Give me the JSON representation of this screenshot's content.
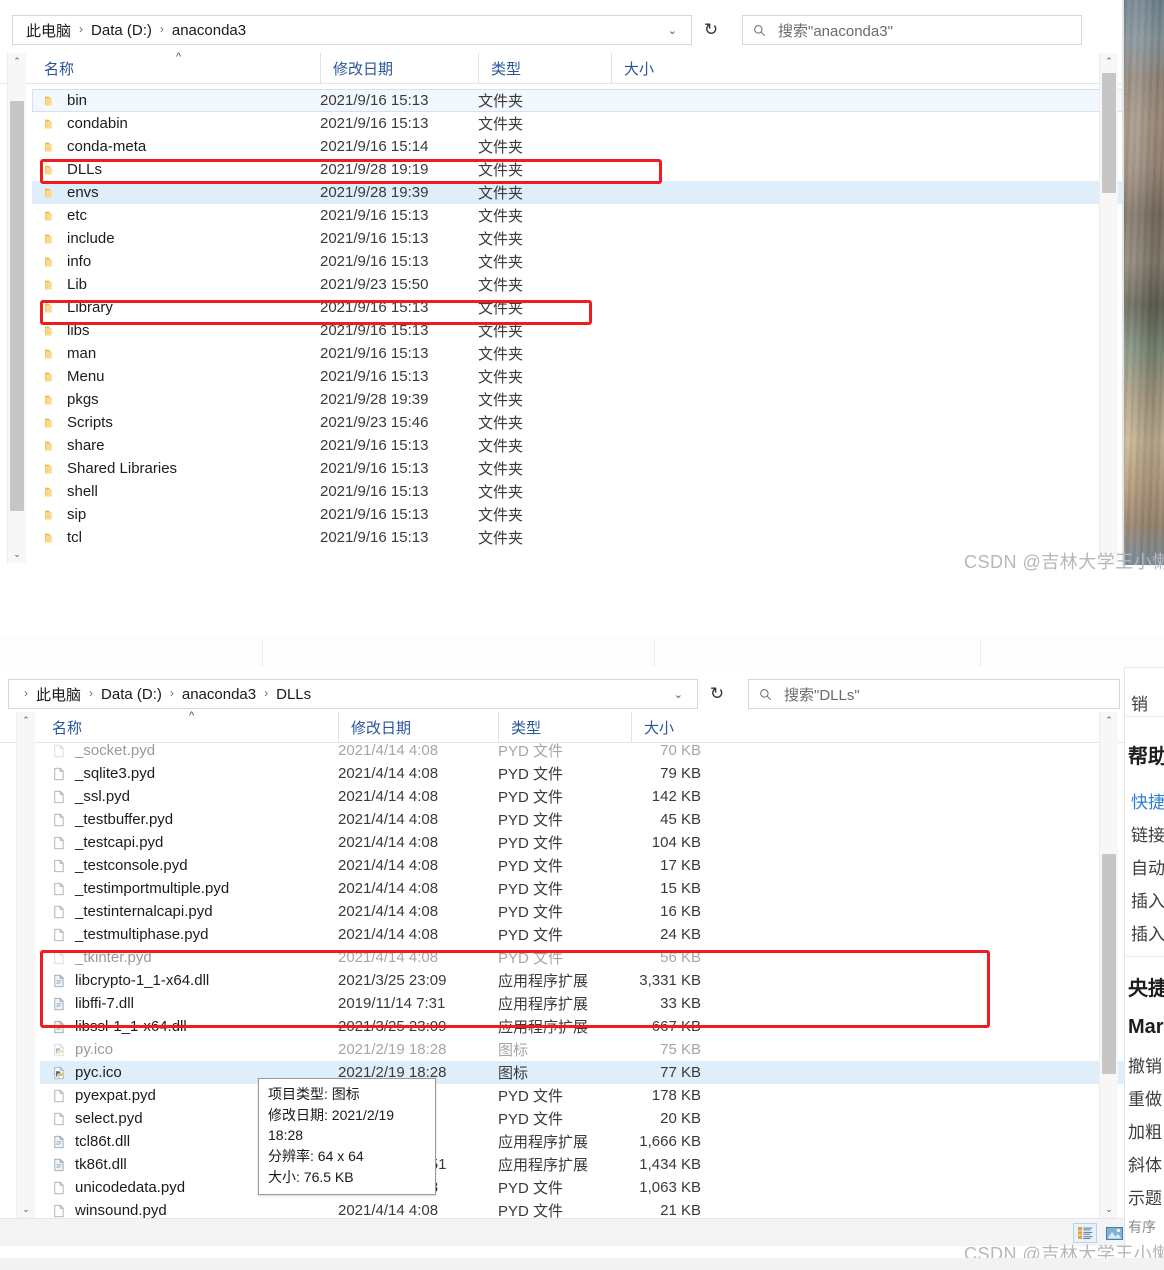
{
  "colors": {
    "annotation_red": "#ee1c1c",
    "selection_blue": "#dfeefb",
    "header_text_blue": "#2a5699",
    "watermark_gray": "#b7b7b7"
  },
  "watermark": {
    "text": "CSDN @吉林大学王小懒"
  },
  "window_top": {
    "breadcrumb": [
      "此电脑",
      "Data (D:)",
      "anaconda3"
    ],
    "breadcrumb_separator": "›",
    "address_caret": "⌄",
    "refresh_icon": "refresh-icon",
    "search": {
      "icon": "search-icon",
      "placeholder": "搜索\"anaconda3\""
    },
    "columns": [
      {
        "label": "名称",
        "sorted": true,
        "sort_dir": "asc"
      },
      {
        "label": "修改日期"
      },
      {
        "label": "类型"
      },
      {
        "label": "大小"
      }
    ],
    "rows": [
      {
        "name": "bin",
        "date": "2021/9/16 15:13",
        "type": "文件夹",
        "size": "",
        "icon": "folder-icon",
        "state": "focus"
      },
      {
        "name": "condabin",
        "date": "2021/9/16 15:13",
        "type": "文件夹",
        "size": "",
        "icon": "folder-icon",
        "state": ""
      },
      {
        "name": "conda-meta",
        "date": "2021/9/16 15:14",
        "type": "文件夹",
        "size": "",
        "icon": "folder-icon",
        "state": ""
      },
      {
        "name": "DLLs",
        "date": "2021/9/28 19:19",
        "type": "文件夹",
        "size": "",
        "icon": "folder-icon",
        "state": ""
      },
      {
        "name": "envs",
        "date": "2021/9/28 19:39",
        "type": "文件夹",
        "size": "",
        "icon": "folder-icon",
        "state": "selected"
      },
      {
        "name": "etc",
        "date": "2021/9/16 15:13",
        "type": "文件夹",
        "size": "",
        "icon": "folder-icon",
        "state": ""
      },
      {
        "name": "include",
        "date": "2021/9/16 15:13",
        "type": "文件夹",
        "size": "",
        "icon": "folder-icon",
        "state": ""
      },
      {
        "name": "info",
        "date": "2021/9/16 15:13",
        "type": "文件夹",
        "size": "",
        "icon": "folder-icon",
        "state": ""
      },
      {
        "name": "Lib",
        "date": "2021/9/23 15:50",
        "type": "文件夹",
        "size": "",
        "icon": "folder-icon",
        "state": ""
      },
      {
        "name": "Library",
        "date": "2021/9/16 15:13",
        "type": "文件夹",
        "size": "",
        "icon": "folder-icon",
        "state": ""
      },
      {
        "name": "libs",
        "date": "2021/9/16 15:13",
        "type": "文件夹",
        "size": "",
        "icon": "folder-icon",
        "state": ""
      },
      {
        "name": "man",
        "date": "2021/9/16 15:13",
        "type": "文件夹",
        "size": "",
        "icon": "folder-icon",
        "state": ""
      },
      {
        "name": "Menu",
        "date": "2021/9/16 15:13",
        "type": "文件夹",
        "size": "",
        "icon": "folder-icon",
        "state": ""
      },
      {
        "name": "pkgs",
        "date": "2021/9/28 19:39",
        "type": "文件夹",
        "size": "",
        "icon": "folder-icon",
        "state": ""
      },
      {
        "name": "Scripts",
        "date": "2021/9/23 15:46",
        "type": "文件夹",
        "size": "",
        "icon": "folder-icon",
        "state": ""
      },
      {
        "name": "share",
        "date": "2021/9/16 15:13",
        "type": "文件夹",
        "size": "",
        "icon": "folder-icon",
        "state": ""
      },
      {
        "name": "Shared Libraries",
        "date": "2021/9/16 15:13",
        "type": "文件夹",
        "size": "",
        "icon": "folder-icon",
        "state": ""
      },
      {
        "name": "shell",
        "date": "2021/9/16 15:13",
        "type": "文件夹",
        "size": "",
        "icon": "folder-icon",
        "state": ""
      },
      {
        "name": "sip",
        "date": "2021/9/16 15:13",
        "type": "文件夹",
        "size": "",
        "icon": "folder-icon",
        "state": ""
      },
      {
        "name": "tcl",
        "date": "2021/9/16 15:13",
        "type": "文件夹",
        "size": "",
        "icon": "folder-icon",
        "state": ""
      }
    ],
    "annotations": [
      {
        "target": "DLLs",
        "label": "highlight-dlls-folder"
      },
      {
        "target": "Library",
        "label": "highlight-library-folder"
      }
    ]
  },
  "window_bottom": {
    "breadcrumb": [
      "此电脑",
      "Data (D:)",
      "anaconda3",
      "DLLs"
    ],
    "breadcrumb_separator": "›",
    "breadcrumb_lead": "›",
    "address_caret": "⌄",
    "refresh_icon": "refresh-icon",
    "search": {
      "icon": "search-icon",
      "placeholder": "搜索\"DLLs\""
    },
    "columns": [
      {
        "label": "名称",
        "sorted": true,
        "sort_dir": "asc"
      },
      {
        "label": "修改日期"
      },
      {
        "label": "类型"
      },
      {
        "label": "大小"
      }
    ],
    "rows": [
      {
        "name": "_socket.pyd",
        "date": "2021/4/14 4:08",
        "type": "PYD 文件",
        "size": "70 KB",
        "icon": "file-icon",
        "state": "clipped"
      },
      {
        "name": "_sqlite3.pyd",
        "date": "2021/4/14 4:08",
        "type": "PYD 文件",
        "size": "79 KB",
        "icon": "file-icon",
        "state": ""
      },
      {
        "name": "_ssl.pyd",
        "date": "2021/4/14 4:08",
        "type": "PYD 文件",
        "size": "142 KB",
        "icon": "file-icon",
        "state": ""
      },
      {
        "name": "_testbuffer.pyd",
        "date": "2021/4/14 4:08",
        "type": "PYD 文件",
        "size": "45 KB",
        "icon": "file-icon",
        "state": ""
      },
      {
        "name": "_testcapi.pyd",
        "date": "2021/4/14 4:08",
        "type": "PYD 文件",
        "size": "104 KB",
        "icon": "file-icon",
        "state": ""
      },
      {
        "name": "_testconsole.pyd",
        "date": "2021/4/14 4:08",
        "type": "PYD 文件",
        "size": "17 KB",
        "icon": "file-icon",
        "state": ""
      },
      {
        "name": "_testimportmultiple.pyd",
        "date": "2021/4/14 4:08",
        "type": "PYD 文件",
        "size": "15 KB",
        "icon": "file-icon",
        "state": ""
      },
      {
        "name": "_testinternalcapi.pyd",
        "date": "2021/4/14 4:08",
        "type": "PYD 文件",
        "size": "16 KB",
        "icon": "file-icon",
        "state": ""
      },
      {
        "name": "_testmultiphase.pyd",
        "date": "2021/4/14 4:08",
        "type": "PYD 文件",
        "size": "24 KB",
        "icon": "file-icon",
        "state": ""
      },
      {
        "name": "_tkinter.pyd",
        "date": "2021/4/14 4:08",
        "type": "PYD 文件",
        "size": "56 KB",
        "icon": "file-icon",
        "state": "clipped"
      },
      {
        "name": "libcrypto-1_1-x64.dll",
        "date": "2021/3/25 23:09",
        "type": "应用程序扩展",
        "size": "3,331 KB",
        "icon": "dll-icon",
        "state": ""
      },
      {
        "name": "libffi-7.dll",
        "date": "2019/11/14 7:31",
        "type": "应用程序扩展",
        "size": "33 KB",
        "icon": "dll-icon",
        "state": ""
      },
      {
        "name": "libssl-1_1-x64.dll",
        "date": "2021/3/25 23:09",
        "type": "应用程序扩展",
        "size": "667 KB",
        "icon": "dll-icon",
        "state": ""
      },
      {
        "name": "py.ico",
        "date": "2021/2/19 18:28",
        "type": "图标",
        "size": "75 KB",
        "icon": "ico-icon",
        "state": "clipped"
      },
      {
        "name": "pyc.ico",
        "date": "2021/2/19 18:28",
        "type": "图标",
        "size": "77 KB",
        "icon": "ico-icon",
        "state": "selected"
      },
      {
        "name": "pyexpat.pyd",
        "date": "",
        "type": "PYD 文件",
        "size": "178 KB",
        "icon": "file-icon",
        "state": ""
      },
      {
        "name": "select.pyd",
        "date": "",
        "type": "PYD 文件",
        "size": "20 KB",
        "icon": "file-icon",
        "state": ""
      },
      {
        "name": "tcl86t.dll",
        "date": "",
        "type": "应用程序扩展",
        "size": "1,666 KB",
        "icon": "dll-icon",
        "state": ""
      },
      {
        "name": "tk86t.dll",
        "date": "2018/12/14 6:51",
        "type": "应用程序扩展",
        "size": "1,434 KB",
        "icon": "dll-icon",
        "state": ""
      },
      {
        "name": "unicodedata.pyd",
        "date": "2021/4/14 4:08",
        "type": "PYD 文件",
        "size": "1,063 KB",
        "icon": "file-icon",
        "state": ""
      },
      {
        "name": "winsound.pyd",
        "date": "2021/4/14 4:08",
        "type": "PYD 文件",
        "size": "21 KB",
        "icon": "file-icon",
        "state": ""
      }
    ],
    "tooltip": {
      "lines": [
        "项目类型: 图标",
        "修改日期: 2021/2/19 18:28",
        "分辨率: 64 x 64",
        "大小: 76.5 KB"
      ]
    },
    "annotations": [
      {
        "target": "libcrypto-1_1-x64.dll … libssl-1_1-x64.dll",
        "label": "highlight-openssl-dlls"
      }
    ],
    "view_buttons": [
      {
        "name": "details-view-button",
        "active": true
      },
      {
        "name": "large-icons-view-button",
        "active": false
      }
    ]
  },
  "side_panel": {
    "items": [
      "销",
      "帮助",
      "快捷",
      "链接",
      "自动",
      "插入",
      "插入",
      "央捷",
      "Mark",
      "撤销",
      "重做",
      "加粗",
      "斜体",
      "示题",
      "有序"
    ]
  }
}
